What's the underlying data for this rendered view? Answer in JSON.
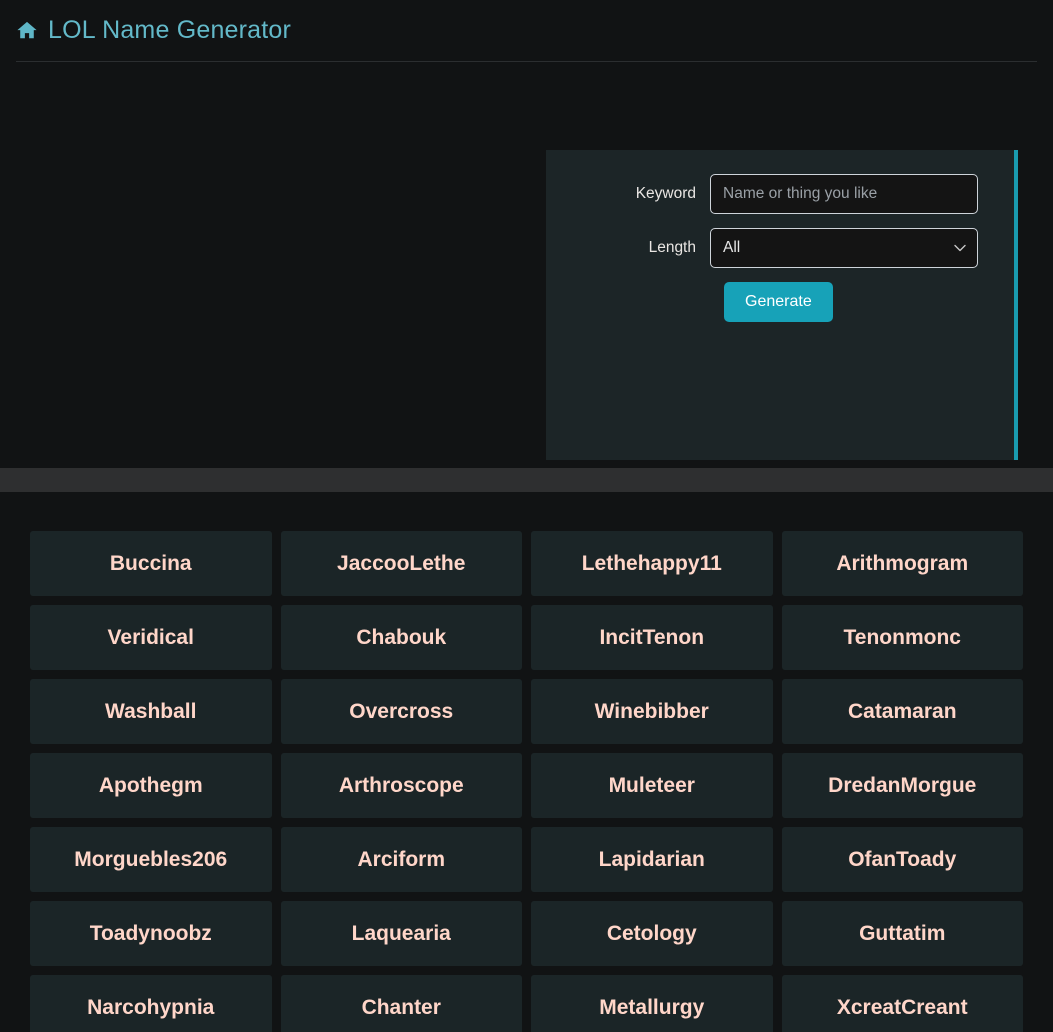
{
  "header": {
    "home_icon": "home-icon",
    "title": "LOL Name Generator"
  },
  "form": {
    "keyword_label": "Keyword",
    "keyword_value": "",
    "keyword_placeholder": "Name or thing you like",
    "length_label": "Length",
    "length_value": "All",
    "length_caret_icon": "chevron-down-icon",
    "generate_label": "Generate"
  },
  "results": {
    "names": [
      "Buccina",
      "JaccooLethe",
      "Lethehappy11",
      "Arithmogram",
      "Veridical",
      "Chabouk",
      "IncitTenon",
      "Tenonmonc",
      "Washball",
      "Overcross",
      "Winebibber",
      "Catamaran",
      "Apothegm",
      "Arthroscope",
      "Muleteer",
      "DredanMorgue",
      "Morguebles206",
      "Arciform",
      "Lapidarian",
      "OfanToady",
      "Toadynoobz",
      "Laquearia",
      "Cetology",
      "Guttatim",
      "Narcohypnia",
      "Chanter",
      "Metallurgy",
      "XcreatCreant"
    ]
  },
  "colors": {
    "accent_teal": "#17a2b8",
    "brand_teal": "#63b9c9",
    "name_text": "#ffd6c9",
    "card_bg": "#1b2527",
    "page_bg": "#111314",
    "band_gray": "#2e2f30"
  }
}
